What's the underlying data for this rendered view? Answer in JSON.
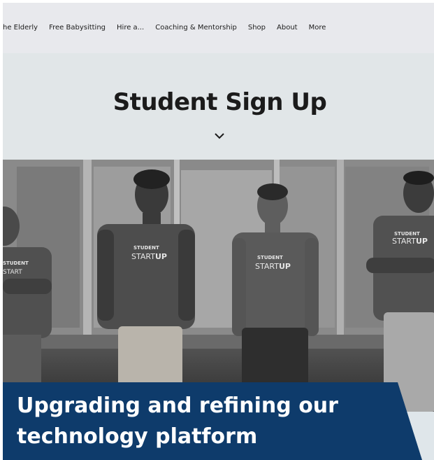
{
  "nav": {
    "items": [
      {
        "label": "he Elderly"
      },
      {
        "label": "Free Babysitting"
      },
      {
        "label": "Hire a..."
      },
      {
        "label": "Coaching & Mentorship"
      },
      {
        "label": "Shop"
      },
      {
        "label": "About"
      },
      {
        "label": "More"
      }
    ]
  },
  "hero": {
    "title": "Student Sign Up",
    "scroll_icon": "chevron-down-icon"
  },
  "photo": {
    "shirt_text_top": "STUDENT",
    "shirt_text_bottom_light": "START",
    "shirt_text_bottom_bold": "UP"
  },
  "banner": {
    "line1": "Upgrading and refining our",
    "line2": "technology platform"
  },
  "colors": {
    "banner_bg": "#0e3b6b",
    "nav_bg": "#e8e9ed",
    "hero_bg": "#e1e6e8",
    "title": "#1b1b1b"
  }
}
